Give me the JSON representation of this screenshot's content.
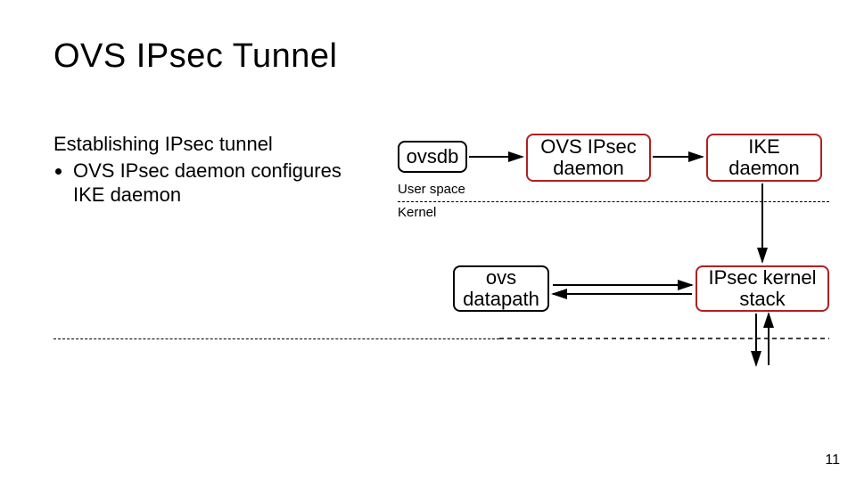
{
  "title": "OVS IPsec Tunnel",
  "subtitle": "Establishing IPsec tunnel",
  "bullets": [
    "OVS IPsec daemon configures IKE daemon"
  ],
  "boxes": {
    "ovsdb": "ovsdb",
    "ovs_ipsec_daemon": "OVS IPsec daemon",
    "ike_daemon": "IKE daemon",
    "ovs_datapath": "ovs datapath",
    "ipsec_kernel_stack": "IPsec kernel stack"
  },
  "labels": {
    "user_space": "User space",
    "kernel": "Kernel"
  },
  "page_number": "11",
  "colors": {
    "accent": "#b02020"
  }
}
